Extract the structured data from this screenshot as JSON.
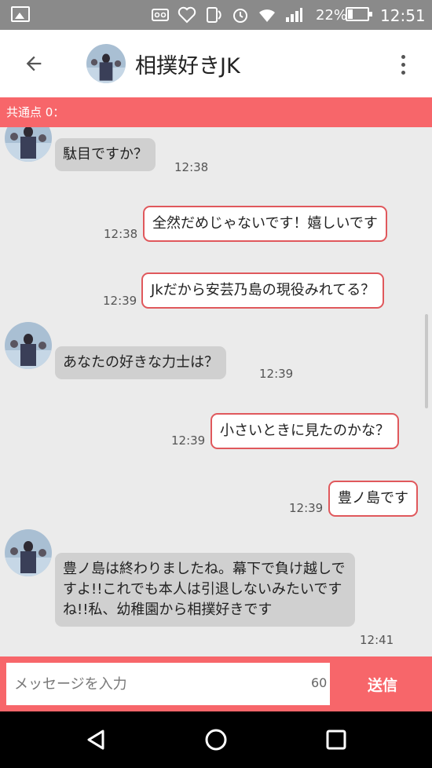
{
  "status_bar": {
    "battery_percent": "22%",
    "time": "12:51",
    "icons": [
      "image-icon",
      "voicemail-icon",
      "heart-app-icon",
      "nfc-icon",
      "alarm-icon",
      "wifi-icon",
      "signal-icon",
      "battery-icon"
    ]
  },
  "header": {
    "title": "相撲好きJK",
    "back_icon": "arrow-back-icon",
    "menu_icon": "more-vert-icon"
  },
  "common_bar": {
    "label": "共通点 0："
  },
  "messages": [
    {
      "side": "in",
      "text": "駄目ですか？",
      "time": "12:38"
    },
    {
      "side": "out",
      "text": "全然だめじゃないです！嬉しいです",
      "time": "12:38"
    },
    {
      "side": "out",
      "text": "Jkだから安芸乃島の現役みれてる？",
      "time": "12:39"
    },
    {
      "side": "in",
      "text": "あなたの好きな力士は？",
      "time": "12:39"
    },
    {
      "side": "out",
      "text": "小さいときに見たのかな？",
      "time": "12:39"
    },
    {
      "side": "out",
      "text": "豊ノ島です",
      "time": "12:39"
    },
    {
      "side": "in",
      "text": "豊ノ島は終わりましたね。幕下で負け越しですよ!!これでも本人は引退しないみたいですね!!私、幼稚園から相撲好きです",
      "time": "12:41"
    }
  ],
  "input": {
    "placeholder": "メッセージを入力",
    "char_count": "60",
    "send_label": "送信"
  },
  "nav": {
    "icons": [
      "back-triangle-icon",
      "home-circle-icon",
      "recents-square-icon"
    ]
  },
  "colors": {
    "accent": "#f7666a",
    "bubble_in": "#d0d0d0",
    "bubble_out_border": "#e0585c"
  }
}
